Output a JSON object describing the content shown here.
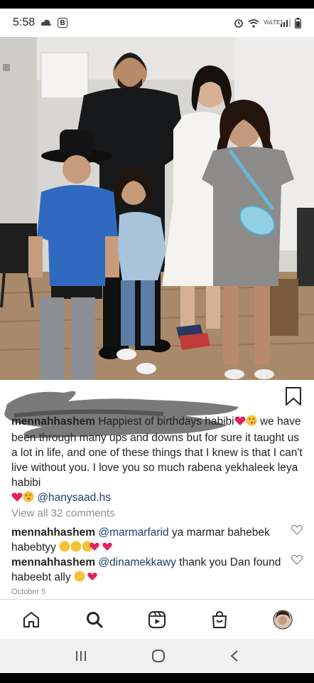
{
  "status_bar": {
    "time": "5:58",
    "carrier_text": "VoLTE1",
    "badge_letter": "B"
  },
  "post": {
    "caption_user": "mennahhashem",
    "caption_text_1": "Happiest of birthdays habibi",
    "caption_text_2": "we have been through many ups and downs but for sure it taught us a lot in life, and one of these things that I knew is that I can't live without you. I love you so much rabena yekhaleek leya habibi",
    "caption_mention": "@hanysaad.hs",
    "view_all_comments": "View all 32 comments",
    "comments": [
      {
        "user": "mennahhashem",
        "mention": "@marmarfarid",
        "text": "ya marmar bahebek habebtyy"
      },
      {
        "user": "mennahhashem",
        "mention": "@dinamekkawy",
        "text": "thank you Dan found habeebt ally"
      }
    ],
    "date": "October 5"
  },
  "icons": {
    "bookmark": "bookmark-icon",
    "heart": "heart-outline-icon",
    "home": "home-icon",
    "search": "search-icon",
    "reels": "reels-icon",
    "shop": "shop-icon",
    "profile": "profile-avatar",
    "recent_apps": "recent-apps-icon",
    "home_button": "home-circle-icon",
    "back": "back-chevron-icon"
  },
  "colors": {
    "mention": "#1b3f6e",
    "heart_red": "#e0245e",
    "muted": "#8e8e8e"
  }
}
